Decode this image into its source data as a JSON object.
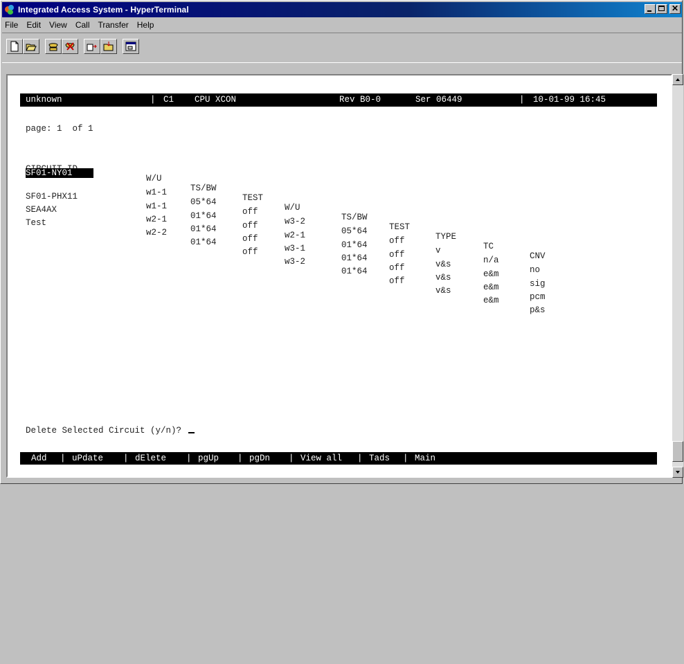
{
  "window": {
    "title": "Integrated Access System - HyperTerminal"
  },
  "menu": [
    "File",
    "Edit",
    "View",
    "Call",
    "Transfer",
    "Help"
  ],
  "toolbar": [
    "new-icon",
    "open-icon",
    "connect-icon",
    "disconnect-icon",
    "send-icon",
    "receive-icon",
    "properties-icon"
  ],
  "status": {
    "name": "unknown",
    "slot": "C1",
    "card": "CPU XCON",
    "rev": "Rev B0-0",
    "ser": "Ser 06449",
    "datetime": "10-01-99 16:45"
  },
  "page_label": "page: 1  of 1",
  "table": {
    "headers": [
      "CIRCUIT ID",
      "W/U",
      "TS/BW",
      "TEST",
      "W/U",
      "TS/BW",
      "TEST",
      "TYPE",
      "TC",
      "CNV"
    ],
    "rows": [
      [
        "SF01-NY01",
        "w1-1",
        "05*64",
        "off",
        "w3-2",
        "05*64",
        "off",
        "v",
        "n/a",
        "no"
      ],
      [
        "SF01-PHX11",
        "w1-1",
        "01*64",
        "off",
        "w2-1",
        "01*64",
        "off",
        "v&s",
        "e&m",
        "sig"
      ],
      [
        "SEA4AX",
        "w2-1",
        "01*64",
        "off",
        "w3-1",
        "01*64",
        "off",
        "v&s",
        "e&m",
        "pcm"
      ],
      [
        "Test",
        "w2-2",
        "01*64",
        "off",
        "w3-2",
        "01*64",
        "off",
        "v&s",
        "e&m",
        "p&s"
      ]
    ]
  },
  "prompt": "Delete Selected Circuit (y/n)?",
  "commands": [
    "Add",
    "uPdate",
    "dElete",
    "pgUp",
    "pgDn",
    "View all",
    "Tads",
    "Main"
  ]
}
